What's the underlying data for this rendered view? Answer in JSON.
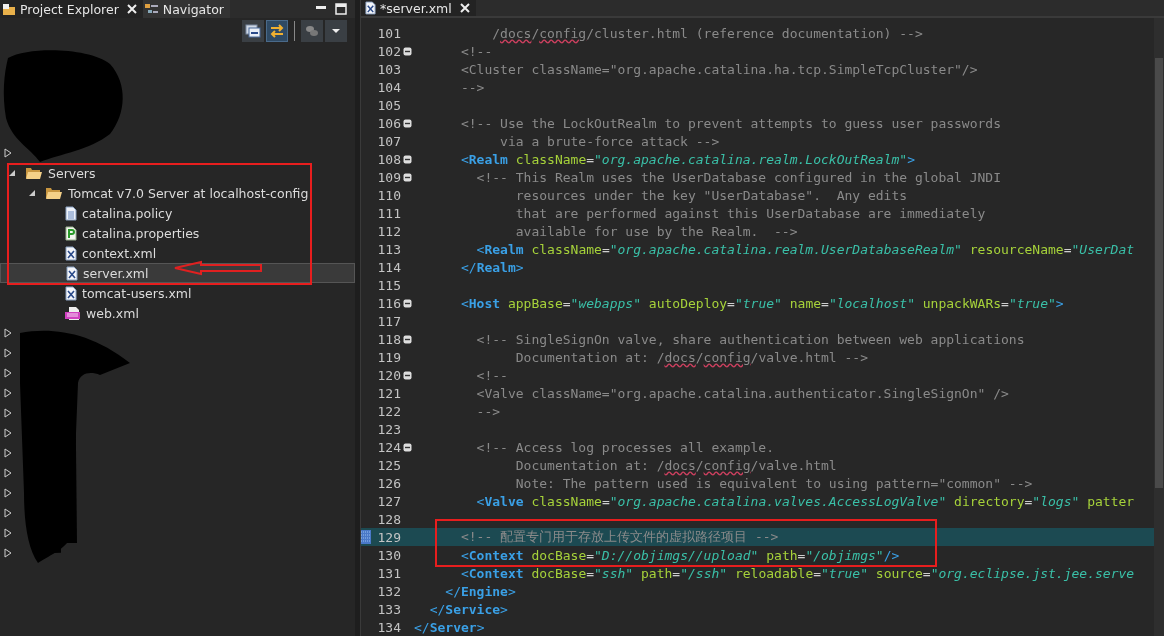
{
  "left_panel": {
    "tabs": [
      {
        "label": "Project Explorer",
        "selected": true,
        "closable": true
      },
      {
        "label": "Navigator",
        "selected": false,
        "closable": false
      }
    ],
    "toolbar": [
      {
        "kind": "collapse",
        "pressed": false
      },
      {
        "kind": "link",
        "pressed": true
      },
      {
        "kind": "filter",
        "pressed": false
      },
      {
        "kind": "menu",
        "pressed": false
      }
    ],
    "hidden_rows_top": [
      {
        "expanded": false
      }
    ],
    "tree": [
      {
        "label": "Servers",
        "kind": "folder",
        "expanded": true,
        "selected": false,
        "children": [
          {
            "label": "Tomcat v7.0 Server at localhost-config",
            "kind": "folder",
            "expanded": true,
            "selected": false,
            "children": [
              {
                "label": "catalina.policy",
                "kind": "text",
                "selected": false
              },
              {
                "label": "catalina.properties",
                "kind": "properties",
                "selected": false
              },
              {
                "label": "context.xml",
                "kind": "xml",
                "selected": false
              },
              {
                "label": "server.xml",
                "kind": "xml",
                "selected": true
              },
              {
                "label": "tomcat-users.xml",
                "kind": "xml",
                "selected": false
              },
              {
                "label": "web.xml",
                "kind": "xmlpink",
                "selected": false
              }
            ]
          }
        ]
      }
    ],
    "hidden_rows_bottom": [
      {
        "expanded": false
      },
      {
        "expanded": false
      },
      {
        "expanded": false
      },
      {
        "expanded": false
      },
      {
        "expanded": false
      },
      {
        "expanded": false
      },
      {
        "expanded": false
      },
      {
        "expanded": false
      },
      {
        "expanded": false
      },
      {
        "expanded": false
      },
      {
        "expanded": false
      },
      {
        "expanded": false
      }
    ]
  },
  "editor": {
    "tab": {
      "label": "*server.xml",
      "selected": true
    },
    "lines": [
      {
        "number": "101",
        "fold": false,
        "current": false,
        "tokens": [
          {
            "kind": "comment",
            "text": "          /"
          },
          {
            "kind": "misspelled",
            "text": "docs"
          },
          {
            "kind": "comment",
            "text": "/"
          },
          {
            "kind": "misspelled",
            "text": "config"
          },
          {
            "kind": "comment",
            "text": "/cluster.html (reference documentation) -->"
          }
        ]
      },
      {
        "number": "102",
        "fold": true,
        "current": false,
        "tokens": [
          {
            "kind": "comment",
            "text": "      <!--"
          }
        ]
      },
      {
        "number": "103",
        "fold": false,
        "current": false,
        "tokens": [
          {
            "kind": "comment",
            "text": "      <Cluster className=\"org.apache.catalina.ha.tcp.SimpleTcpCluster\"/>"
          }
        ]
      },
      {
        "number": "104",
        "fold": false,
        "current": false,
        "tokens": [
          {
            "kind": "comment",
            "text": "      -->"
          }
        ]
      },
      {
        "number": "105",
        "fold": false,
        "current": false
      },
      {
        "number": "106",
        "fold": true,
        "current": false,
        "tokens": [
          {
            "kind": "comment",
            "text": "      <!-- Use the LockOutRealm to prevent attempts to guess user passwords"
          }
        ]
      },
      {
        "number": "107",
        "fold": false,
        "current": false,
        "tokens": [
          {
            "kind": "comment",
            "text": "           via a brute-force attack -->"
          }
        ]
      },
      {
        "number": "108",
        "fold": true,
        "current": false,
        "tokens": [
          {
            "kind": "bracket",
            "text": "      <"
          },
          {
            "kind": "tag",
            "text": "Realm"
          },
          {
            "kind": "attr",
            "text": " className"
          },
          {
            "kind": "plain",
            "text": "="
          },
          {
            "kind": "value",
            "text": "\"org.apache.catalina.realm.LockOutRealm\""
          },
          {
            "kind": "bracket",
            "text": ">"
          }
        ]
      },
      {
        "number": "109",
        "fold": true,
        "current": false,
        "tokens": [
          {
            "kind": "comment",
            "text": "        <!-- This Realm uses the UserDatabase configured in the global JNDI"
          }
        ]
      },
      {
        "number": "110",
        "fold": false,
        "current": false,
        "tokens": [
          {
            "kind": "comment",
            "text": "             resources under the key \"UserDatabase\".  Any edits"
          }
        ]
      },
      {
        "number": "111",
        "fold": false,
        "current": false,
        "tokens": [
          {
            "kind": "comment",
            "text": "             that are performed against this UserDatabase are immediately"
          }
        ]
      },
      {
        "number": "112",
        "fold": false,
        "current": false,
        "tokens": [
          {
            "kind": "comment",
            "text": "             available for use by the Realm.  -->"
          }
        ]
      },
      {
        "number": "113",
        "fold": false,
        "current": false,
        "tokens": [
          {
            "kind": "bracket",
            "text": "        <"
          },
          {
            "kind": "tag",
            "text": "Realm"
          },
          {
            "kind": "attr",
            "text": " className"
          },
          {
            "kind": "plain",
            "text": "="
          },
          {
            "kind": "value",
            "text": "\"org.apache.catalina.realm.UserDatabaseRealm\""
          },
          {
            "kind": "attr",
            "text": " resourceName"
          },
          {
            "kind": "plain",
            "text": "="
          },
          {
            "kind": "value",
            "text": "\"UserDat"
          }
        ]
      },
      {
        "number": "114",
        "fold": false,
        "current": false,
        "tokens": [
          {
            "kind": "bracket",
            "text": "      </"
          },
          {
            "kind": "tag",
            "text": "Realm"
          },
          {
            "kind": "bracket",
            "text": ">"
          }
        ]
      },
      {
        "number": "115",
        "fold": false,
        "current": false
      },
      {
        "number": "116",
        "fold": true,
        "current": false,
        "tokens": [
          {
            "kind": "bracket",
            "text": "      <"
          },
          {
            "kind": "tag",
            "text": "Host"
          },
          {
            "kind": "attr",
            "text": " appBase"
          },
          {
            "kind": "plain",
            "text": "="
          },
          {
            "kind": "value",
            "text": "\"webapps\""
          },
          {
            "kind": "attr",
            "text": " autoDeploy"
          },
          {
            "kind": "plain",
            "text": "="
          },
          {
            "kind": "value",
            "text": "\"true\""
          },
          {
            "kind": "attr",
            "text": " name"
          },
          {
            "kind": "plain",
            "text": "="
          },
          {
            "kind": "value",
            "text": "\"localhost\""
          },
          {
            "kind": "attr",
            "text": " unpackWARs"
          },
          {
            "kind": "plain",
            "text": "="
          },
          {
            "kind": "value",
            "text": "\"true\""
          },
          {
            "kind": "bracket",
            "text": ">"
          }
        ]
      },
      {
        "number": "117",
        "fold": false,
        "current": false
      },
      {
        "number": "118",
        "fold": true,
        "current": false,
        "tokens": [
          {
            "kind": "comment",
            "text": "        <!-- SingleSignOn valve, share authentication between web applications"
          }
        ]
      },
      {
        "number": "119",
        "fold": false,
        "current": false,
        "tokens": [
          {
            "kind": "comment",
            "text": "             Documentation at: /"
          },
          {
            "kind": "misspelled",
            "text": "docs"
          },
          {
            "kind": "comment",
            "text": "/"
          },
          {
            "kind": "misspelled",
            "text": "config"
          },
          {
            "kind": "comment",
            "text": "/valve.html -->"
          }
        ]
      },
      {
        "number": "120",
        "fold": true,
        "current": false,
        "tokens": [
          {
            "kind": "comment",
            "text": "        <!--"
          }
        ]
      },
      {
        "number": "121",
        "fold": false,
        "current": false,
        "tokens": [
          {
            "kind": "comment",
            "text": "        <Valve className=\"org.apache.catalina.authenticator.SingleSignOn\" />"
          }
        ]
      },
      {
        "number": "122",
        "fold": false,
        "current": false,
        "tokens": [
          {
            "kind": "comment",
            "text": "        -->"
          }
        ]
      },
      {
        "number": "123",
        "fold": false,
        "current": false
      },
      {
        "number": "124",
        "fold": true,
        "current": false,
        "tokens": [
          {
            "kind": "comment",
            "text": "        <!-- Access log processes all example."
          }
        ]
      },
      {
        "number": "125",
        "fold": false,
        "current": false,
        "tokens": [
          {
            "kind": "comment",
            "text": "             Documentation at: /"
          },
          {
            "kind": "misspelled",
            "text": "docs"
          },
          {
            "kind": "comment",
            "text": "/"
          },
          {
            "kind": "misspelled",
            "text": "config"
          },
          {
            "kind": "comment",
            "text": "/valve.html"
          }
        ]
      },
      {
        "number": "126",
        "fold": false,
        "current": false,
        "tokens": [
          {
            "kind": "comment",
            "text": "             Note: The pattern used is equivalent to using pattern=\"common\" -->"
          }
        ]
      },
      {
        "number": "127",
        "fold": false,
        "current": false,
        "tokens": [
          {
            "kind": "bracket",
            "text": "        <"
          },
          {
            "kind": "tag",
            "text": "Valve"
          },
          {
            "kind": "attr",
            "text": " className"
          },
          {
            "kind": "plain",
            "text": "="
          },
          {
            "kind": "value",
            "text": "\"org.apache.catalina.valves.AccessLogValve\""
          },
          {
            "kind": "attr",
            "text": " directory"
          },
          {
            "kind": "plain",
            "text": "="
          },
          {
            "kind": "value",
            "text": "\"logs\""
          },
          {
            "kind": "attr",
            "text": " patter"
          }
        ]
      },
      {
        "number": "128",
        "fold": false,
        "current": false
      },
      {
        "number": "129",
        "fold": false,
        "current": true,
        "tokens": [
          {
            "kind": "comment",
            "text": "      <!-- 配置专门用于存放上传文件的虚拟路径项目 -->"
          }
        ]
      },
      {
        "number": "130",
        "fold": false,
        "current": false,
        "tokens": [
          {
            "kind": "bracket",
            "text": "      <"
          },
          {
            "kind": "tag",
            "text": "Context"
          },
          {
            "kind": "attr",
            "text": " docBase"
          },
          {
            "kind": "plain",
            "text": "="
          },
          {
            "kind": "value",
            "text": "\"D://objimgs//upload\""
          },
          {
            "kind": "attr",
            "text": " path"
          },
          {
            "kind": "plain",
            "text": "="
          },
          {
            "kind": "value",
            "text": "\"/objimgs\""
          },
          {
            "kind": "bracket",
            "text": "/>"
          }
        ]
      },
      {
        "number": "131",
        "fold": false,
        "current": false,
        "tokens": [
          {
            "kind": "bracket",
            "text": "      <"
          },
          {
            "kind": "tag",
            "text": "Context"
          },
          {
            "kind": "attr",
            "text": " docBase"
          },
          {
            "kind": "plain",
            "text": "="
          },
          {
            "kind": "value",
            "text": "\"ssh\""
          },
          {
            "kind": "attr",
            "text": " path"
          },
          {
            "kind": "plain",
            "text": "="
          },
          {
            "kind": "value",
            "text": "\"/ssh\""
          },
          {
            "kind": "attr",
            "text": " reloadable"
          },
          {
            "kind": "plain",
            "text": "="
          },
          {
            "kind": "value",
            "text": "\"true\""
          },
          {
            "kind": "attr",
            "text": " source"
          },
          {
            "kind": "plain",
            "text": "="
          },
          {
            "kind": "value",
            "text": "\"org.eclipse.jst.jee.serve"
          }
        ]
      },
      {
        "number": "132",
        "fold": false,
        "current": false,
        "tokens": [
          {
            "kind": "bracket",
            "text": "    </"
          },
          {
            "kind": "tag",
            "text": "Engine"
          },
          {
            "kind": "bracket",
            "text": ">"
          }
        ]
      },
      {
        "number": "133",
        "fold": false,
        "current": false,
        "tokens": [
          {
            "kind": "bracket",
            "text": "  </"
          },
          {
            "kind": "tag",
            "text": "Service"
          },
          {
            "kind": "bracket",
            "text": ">"
          }
        ]
      },
      {
        "number": "134",
        "fold": false,
        "current": false,
        "tokens": [
          {
            "kind": "bracket",
            "text": "</"
          },
          {
            "kind": "tag",
            "text": "Server"
          },
          {
            "kind": "bracket",
            "text": ">"
          }
        ]
      }
    ]
  }
}
